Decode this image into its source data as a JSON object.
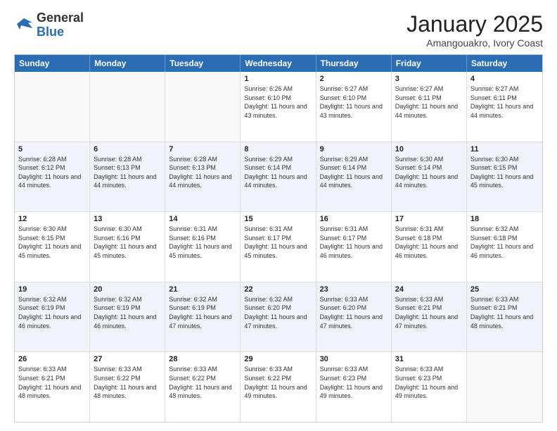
{
  "logo": {
    "general": "General",
    "blue": "Blue"
  },
  "header": {
    "title": "January 2025",
    "subtitle": "Amangouakro, Ivory Coast"
  },
  "weekdays": [
    "Sunday",
    "Monday",
    "Tuesday",
    "Wednesday",
    "Thursday",
    "Friday",
    "Saturday"
  ],
  "rows": [
    [
      {
        "day": "",
        "info": ""
      },
      {
        "day": "",
        "info": ""
      },
      {
        "day": "",
        "info": ""
      },
      {
        "day": "1",
        "info": "Sunrise: 6:26 AM\nSunset: 6:10 PM\nDaylight: 11 hours and 43 minutes."
      },
      {
        "day": "2",
        "info": "Sunrise: 6:27 AM\nSunset: 6:10 PM\nDaylight: 11 hours and 43 minutes."
      },
      {
        "day": "3",
        "info": "Sunrise: 6:27 AM\nSunset: 6:11 PM\nDaylight: 11 hours and 44 minutes."
      },
      {
        "day": "4",
        "info": "Sunrise: 6:27 AM\nSunset: 6:11 PM\nDaylight: 11 hours and 44 minutes."
      }
    ],
    [
      {
        "day": "5",
        "info": "Sunrise: 6:28 AM\nSunset: 6:12 PM\nDaylight: 11 hours and 44 minutes."
      },
      {
        "day": "6",
        "info": "Sunrise: 6:28 AM\nSunset: 6:13 PM\nDaylight: 11 hours and 44 minutes."
      },
      {
        "day": "7",
        "info": "Sunrise: 6:28 AM\nSunset: 6:13 PM\nDaylight: 11 hours and 44 minutes."
      },
      {
        "day": "8",
        "info": "Sunrise: 6:29 AM\nSunset: 6:14 PM\nDaylight: 11 hours and 44 minutes."
      },
      {
        "day": "9",
        "info": "Sunrise: 6:29 AM\nSunset: 6:14 PM\nDaylight: 11 hours and 44 minutes."
      },
      {
        "day": "10",
        "info": "Sunrise: 6:30 AM\nSunset: 6:14 PM\nDaylight: 11 hours and 44 minutes."
      },
      {
        "day": "11",
        "info": "Sunrise: 6:30 AM\nSunset: 6:15 PM\nDaylight: 11 hours and 45 minutes."
      }
    ],
    [
      {
        "day": "12",
        "info": "Sunrise: 6:30 AM\nSunset: 6:15 PM\nDaylight: 11 hours and 45 minutes."
      },
      {
        "day": "13",
        "info": "Sunrise: 6:30 AM\nSunset: 6:16 PM\nDaylight: 11 hours and 45 minutes."
      },
      {
        "day": "14",
        "info": "Sunrise: 6:31 AM\nSunset: 6:16 PM\nDaylight: 11 hours and 45 minutes."
      },
      {
        "day": "15",
        "info": "Sunrise: 6:31 AM\nSunset: 6:17 PM\nDaylight: 11 hours and 45 minutes."
      },
      {
        "day": "16",
        "info": "Sunrise: 6:31 AM\nSunset: 6:17 PM\nDaylight: 11 hours and 46 minutes."
      },
      {
        "day": "17",
        "info": "Sunrise: 6:31 AM\nSunset: 6:18 PM\nDaylight: 11 hours and 46 minutes."
      },
      {
        "day": "18",
        "info": "Sunrise: 6:32 AM\nSunset: 6:18 PM\nDaylight: 11 hours and 46 minutes."
      }
    ],
    [
      {
        "day": "19",
        "info": "Sunrise: 6:32 AM\nSunset: 6:19 PM\nDaylight: 11 hours and 46 minutes."
      },
      {
        "day": "20",
        "info": "Sunrise: 6:32 AM\nSunset: 6:19 PM\nDaylight: 11 hours and 46 minutes."
      },
      {
        "day": "21",
        "info": "Sunrise: 6:32 AM\nSunset: 6:19 PM\nDaylight: 11 hours and 47 minutes."
      },
      {
        "day": "22",
        "info": "Sunrise: 6:32 AM\nSunset: 6:20 PM\nDaylight: 11 hours and 47 minutes."
      },
      {
        "day": "23",
        "info": "Sunrise: 6:33 AM\nSunset: 6:20 PM\nDaylight: 11 hours and 47 minutes."
      },
      {
        "day": "24",
        "info": "Sunrise: 6:33 AM\nSunset: 6:21 PM\nDaylight: 11 hours and 47 minutes."
      },
      {
        "day": "25",
        "info": "Sunrise: 6:33 AM\nSunset: 6:21 PM\nDaylight: 11 hours and 48 minutes."
      }
    ],
    [
      {
        "day": "26",
        "info": "Sunrise: 6:33 AM\nSunset: 6:21 PM\nDaylight: 11 hours and 48 minutes."
      },
      {
        "day": "27",
        "info": "Sunrise: 6:33 AM\nSunset: 6:22 PM\nDaylight: 11 hours and 48 minutes."
      },
      {
        "day": "28",
        "info": "Sunrise: 6:33 AM\nSunset: 6:22 PM\nDaylight: 11 hours and 48 minutes."
      },
      {
        "day": "29",
        "info": "Sunrise: 6:33 AM\nSunset: 6:22 PM\nDaylight: 11 hours and 49 minutes."
      },
      {
        "day": "30",
        "info": "Sunrise: 6:33 AM\nSunset: 6:23 PM\nDaylight: 11 hours and 49 minutes."
      },
      {
        "day": "31",
        "info": "Sunrise: 6:33 AM\nSunset: 6:23 PM\nDaylight: 11 hours and 49 minutes."
      },
      {
        "day": "",
        "info": ""
      }
    ]
  ]
}
